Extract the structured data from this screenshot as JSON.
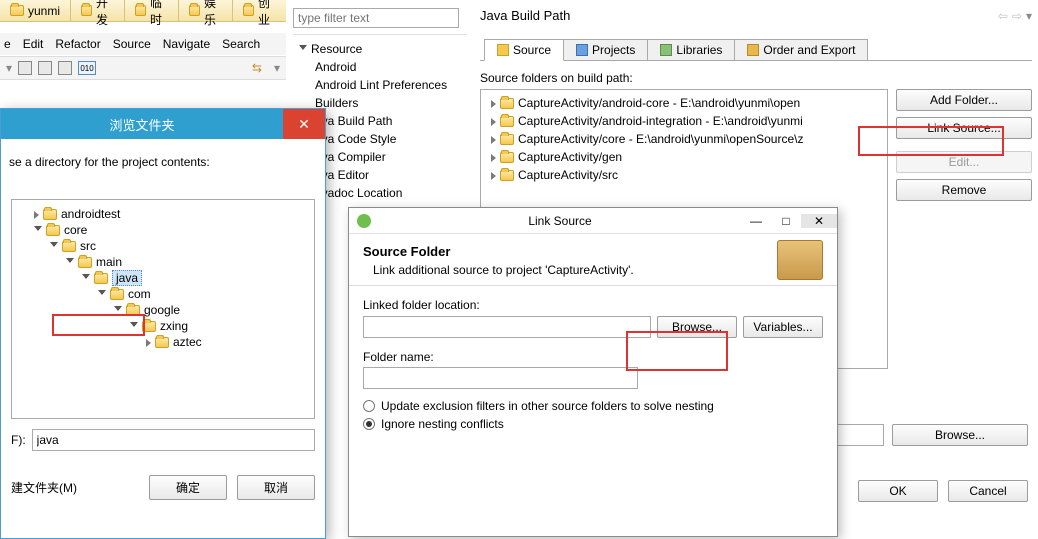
{
  "taskbar_tabs": [
    "yunmi",
    "开发",
    "临时",
    "娱乐",
    "创业"
  ],
  "ide_menu": [
    "e",
    "Edit",
    "Refactor",
    "Source",
    "Navigate",
    "Search"
  ],
  "pref_filter_placeholder": "type filter text",
  "pref_tree": {
    "root": "Resource",
    "items": [
      "Android",
      "Android Lint Preferences",
      "Builders",
      "ava Build Path",
      "ava Code Style",
      "ava Compiler",
      "ava Editor",
      "avadoc Location"
    ]
  },
  "page_title": "Java Build Path",
  "tabs": [
    "Source",
    "Projects",
    "Libraries",
    "Order and Export"
  ],
  "src_label": "Source folders on build path:",
  "src_items": [
    "CaptureActivity/android-core - E:\\android\\yunmi\\open",
    "CaptureActivity/android-integration - E:\\android\\yunmi",
    "CaptureActivity/core - E:\\android\\yunmi\\openSource\\z",
    "CaptureActivity/gen",
    "CaptureActivity/src"
  ],
  "side_buttons": {
    "add": "Add Folder...",
    "link": "Link Source...",
    "edit": "Edit...",
    "remove": "Remove",
    "browse": "Browse..."
  },
  "bottom_buttons": {
    "ok": "OK",
    "cancel": "Cancel"
  },
  "link_dialog": {
    "title": "Link Source",
    "heading": "Source Folder",
    "desc": "Link additional source to project 'CaptureActivity'.",
    "loc_label": "Linked folder location:",
    "browse": "Browse...",
    "vars": "Variables...",
    "name_label": "Folder name:",
    "opt_update": "Update exclusion filters in other source folders to solve nesting",
    "opt_ignore": "Ignore nesting conflicts"
  },
  "browse_dialog": {
    "title": "浏览文件夹",
    "instruction": "se a directory for the project contents:",
    "tree": [
      "androidtest",
      "core",
      "src",
      "main",
      "java",
      "com",
      "google",
      "zxing",
      "aztec"
    ],
    "field_label": "F):",
    "field_value": "java",
    "newfolder": "建文件夹(M)",
    "ok": "确定",
    "cancel": "取消"
  }
}
